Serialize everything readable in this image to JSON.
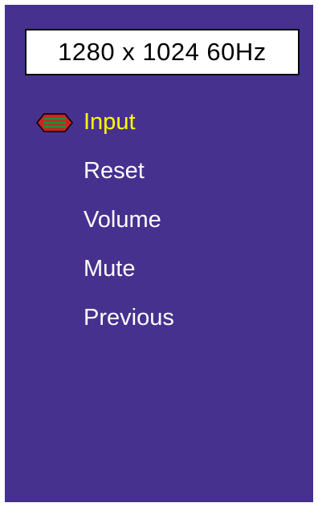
{
  "resolution": {
    "text": "1280 x 1024 60Hz"
  },
  "menu": {
    "items": [
      {
        "label": "Input",
        "selected": true
      },
      {
        "label": "Reset",
        "selected": false
      },
      {
        "label": "Volume",
        "selected": false
      },
      {
        "label": "Mute",
        "selected": false
      },
      {
        "label": "Previous",
        "selected": false
      }
    ]
  },
  "colors": {
    "background": "#47318f",
    "selected_text": "#ffff00",
    "normal_text": "#ffffff",
    "cursor_fill": "#cc2222",
    "cursor_stripes": "#1e8f3a"
  },
  "icons": {
    "selection_cursor": "selection-cursor-icon"
  }
}
